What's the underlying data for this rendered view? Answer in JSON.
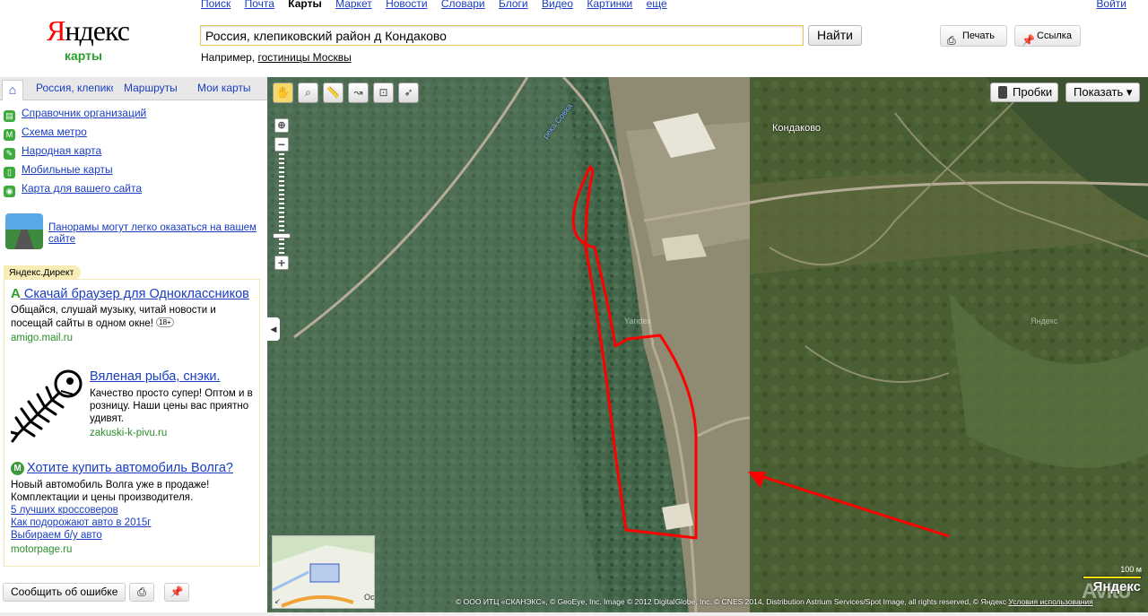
{
  "header": {
    "logo_main": "Яндекс",
    "logo_sub": "карты",
    "services": [
      "Поиск",
      "Почта",
      "Карты",
      "Маркет",
      "Новости",
      "Словари",
      "Блоги",
      "Видео",
      "Картинки",
      "еще"
    ],
    "current_service": "Карты",
    "login": "Войти",
    "search_value": "Россия, клепиковский район д Кондаково",
    "search_button": "Найти",
    "example_prefix": "Например,",
    "example_link": "гостиницы Москвы",
    "print_label": "Печать",
    "link_label": "Ссылка"
  },
  "sidebar": {
    "tabs": [
      "Россия, клепико",
      "Маршруты",
      "Мои карты"
    ],
    "nav_items": [
      {
        "label": "Справочник организаций",
        "icon": "directory-icon"
      },
      {
        "label": "Схема метро",
        "icon": "metro-icon"
      },
      {
        "label": "Народная карта",
        "icon": "people-map-icon"
      },
      {
        "label": "Мобильные карты",
        "icon": "mobile-icon"
      },
      {
        "label": "Карта для вашего сайта",
        "icon": "site-map-icon"
      }
    ],
    "panorama_text": "Панорамы могут легко оказаться на вашем сайте",
    "direct_label": "Яндекс.Директ",
    "ads": [
      {
        "title": "Скачай браузер для Одноклассников",
        "text": "Общайся, слушай музыку, читай новости и посещай сайты в одном окне!",
        "badge": "18+",
        "url": "amigo.mail.ru"
      },
      {
        "title": "Вяленая рыба, снэки.",
        "text": "Качество просто супер! Оптом и в розницу. Наши цены вас приятно удивят.",
        "url": "zakuski-k-pivu.ru"
      },
      {
        "title": "Хотите купить автомобиль Волга?",
        "text": "Новый автомобиль Волга уже в продаже! Комплектации и цены производителя.",
        "links": [
          "5 лучших кроссоверов",
          "Как подорожают авто в 2015г",
          "Выбираем б/у авто"
        ],
        "url": "motorpage.ru"
      }
    ],
    "report_button": "Сообщить об ошибке"
  },
  "map": {
    "traffic_label": "Пробки",
    "show_label": "Показать ▾",
    "places": [
      "Кондаково",
      "река Совка"
    ],
    "watermarks": [
      "Яндекс",
      "Yandex"
    ],
    "minimap_label": "Ос",
    "scale_label": "100 м",
    "copyright": "© ООО ИТЦ «СКАНЭКС», © GeoEye, Inc. Image © 2012 DigitalGlobe, Inc. © CNES 2014, Distribution Astrium Services/Spot Image, all rights reserved, © Яндекс",
    "terms_label": "Условия использования",
    "logo": "Яндекс",
    "avito": "Avito",
    "accent_color": "#ff0000"
  }
}
